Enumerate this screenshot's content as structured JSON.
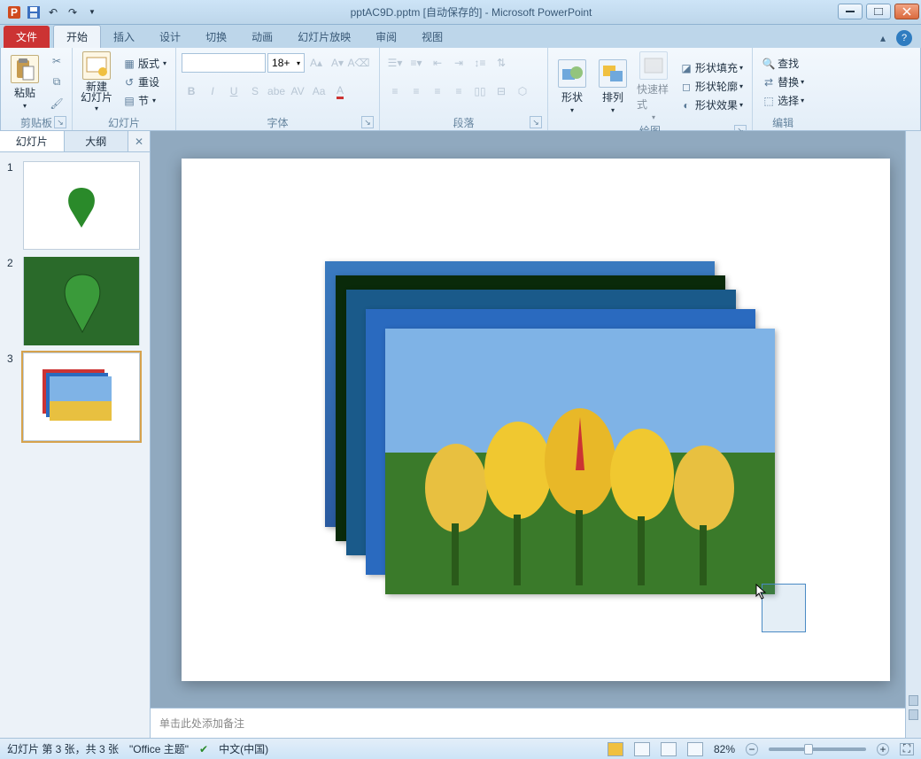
{
  "title": "pptAC9D.pptm [自动保存的] - Microsoft PowerPoint",
  "tabs": {
    "file": "文件",
    "items": [
      "开始",
      "插入",
      "设计",
      "切换",
      "动画",
      "幻灯片放映",
      "审阅",
      "视图"
    ],
    "active": 0
  },
  "ribbon": {
    "clipboard": {
      "paste": "粘贴",
      "label": "剪贴板"
    },
    "slides": {
      "new": "新建\n幻灯片",
      "layout": "版式",
      "reset": "重设",
      "section": "节",
      "label": "幻灯片"
    },
    "font": {
      "size": "18+",
      "label": "字体"
    },
    "para": {
      "label": "段落"
    },
    "draw": {
      "shape": "形状",
      "arrange": "排列",
      "quick": "快速样式",
      "fill": "形状填充",
      "outline": "形状轮廓",
      "effect": "形状效果",
      "label": "绘图"
    },
    "edit": {
      "find": "查找",
      "replace": "替换",
      "select": "选择",
      "label": "编辑"
    }
  },
  "pane": {
    "tabs": [
      "幻灯片",
      "大纲"
    ],
    "active": 0,
    "slides": [
      {
        "n": "1"
      },
      {
        "n": "2"
      },
      {
        "n": "3"
      }
    ],
    "selected": 2
  },
  "notes": "单击此处添加备注",
  "status": {
    "slide": "幻灯片 第 3 张，共 3 张",
    "theme": "\"Office 主题\"",
    "lang": "中文(中国)",
    "zoom": "82%"
  }
}
